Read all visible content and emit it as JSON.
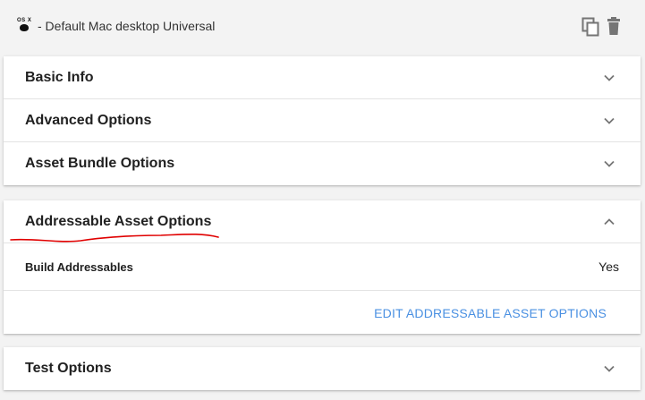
{
  "config": {
    "os_icon_text": "OS X",
    "label": "- Default Mac desktop Universal"
  },
  "toolbar": {
    "icons": [
      "copy-icon",
      "delete-icon"
    ]
  },
  "sections": {
    "basic_info": {
      "title": "Basic Info",
      "expanded": false
    },
    "advanced_options": {
      "title": "Advanced Options",
      "expanded": false
    },
    "asset_bundle_options": {
      "title": "Asset Bundle Options",
      "expanded": false
    },
    "addressable_asset_options": {
      "title": "Addressable Asset Options",
      "expanded": true,
      "rows": [
        {
          "label": "Build Addressables",
          "value": "Yes"
        }
      ],
      "action_label": "EDIT ADDRESSABLE ASSET OPTIONS"
    },
    "test_options": {
      "title": "Test Options",
      "expanded": false
    }
  },
  "colors": {
    "background": "#f3f3f3",
    "card": "#ffffff",
    "link": "#4a90e2",
    "annotation": "#e00000",
    "icon": "#757575"
  }
}
